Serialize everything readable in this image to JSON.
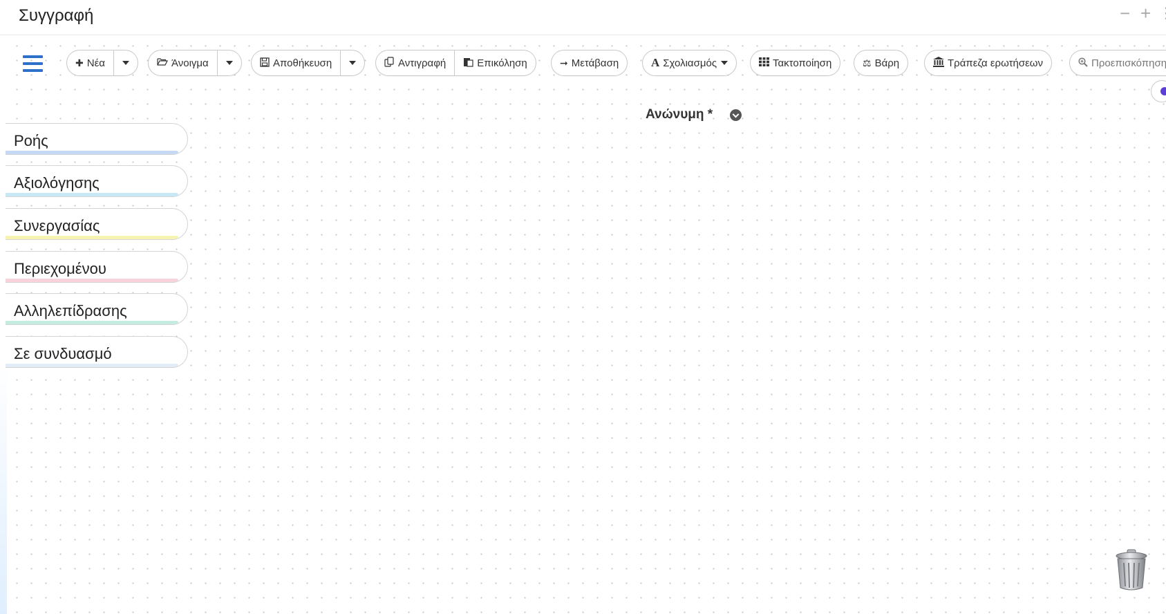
{
  "app": {
    "title": "Συγγραφή"
  },
  "window_controls": {
    "minimize": "−",
    "maximize": "+",
    "more": "⋮"
  },
  "toolbar": {
    "new": "Νέα",
    "open": "Άνοιγμα",
    "save": "Αποθήκευση",
    "copy": "Αντιγραφή",
    "paste": "Επικόληση",
    "goto": "Μετάβαση",
    "annotate": "Σχολιασμός",
    "arrange": "Τακτοποίηση",
    "weights": "Βάρη",
    "question_bank": "Τράπεζα ερωτήσεων",
    "preview": "Προεπισκόπηση"
  },
  "document": {
    "title": "Ανώνυμη *"
  },
  "categories": [
    {
      "label": "Ροής",
      "color": "#c5d9f7"
    },
    {
      "label": "Αξιολόγησης",
      "color": "#c7e8f5"
    },
    {
      "label": "Συνεργασίας",
      "color": "#f8f3b0"
    },
    {
      "label": "Περιεχομένου",
      "color": "#f9d3db"
    },
    {
      "label": "Αλληλεπίδρασης",
      "color": "#c4ece0"
    },
    {
      "label": "Σε συνδυασμό",
      "color": "#e2ebf8"
    }
  ],
  "colors": {
    "accent": "#2d72c8",
    "help": "#5b3fd6"
  },
  "icons": [
    "plus-icon",
    "folder-open-icon",
    "save-icon",
    "copy-icon",
    "paste-icon",
    "arrow-right-icon",
    "font-icon",
    "grid-icon",
    "balance-scale-icon",
    "bank-icon",
    "search-plus-icon",
    "trash-icon"
  ]
}
